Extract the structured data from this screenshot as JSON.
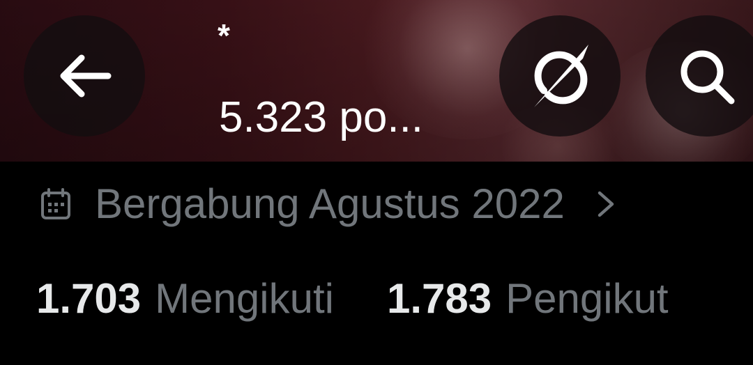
{
  "header": {
    "title": "*",
    "post_count": "5.323 po..."
  },
  "buttons": {
    "back": {
      "icon": "arrow-left-icon"
    },
    "grok": {
      "icon": "grok-icon"
    },
    "search": {
      "icon": "search-icon"
    }
  },
  "profile": {
    "joined_icon": "calendar-icon",
    "joined_text": "Bergabung Agustus 2022",
    "joined_chevron_icon": "chevron-right-icon",
    "following_count": "1.703",
    "following_label": "Mengikuti",
    "followers_count": "1.783",
    "followers_label": "Pengikut"
  },
  "colors": {
    "background": "#000000",
    "primary_text": "#e7e9ea",
    "secondary_text": "#71767b",
    "button_bg": "#140e10"
  }
}
